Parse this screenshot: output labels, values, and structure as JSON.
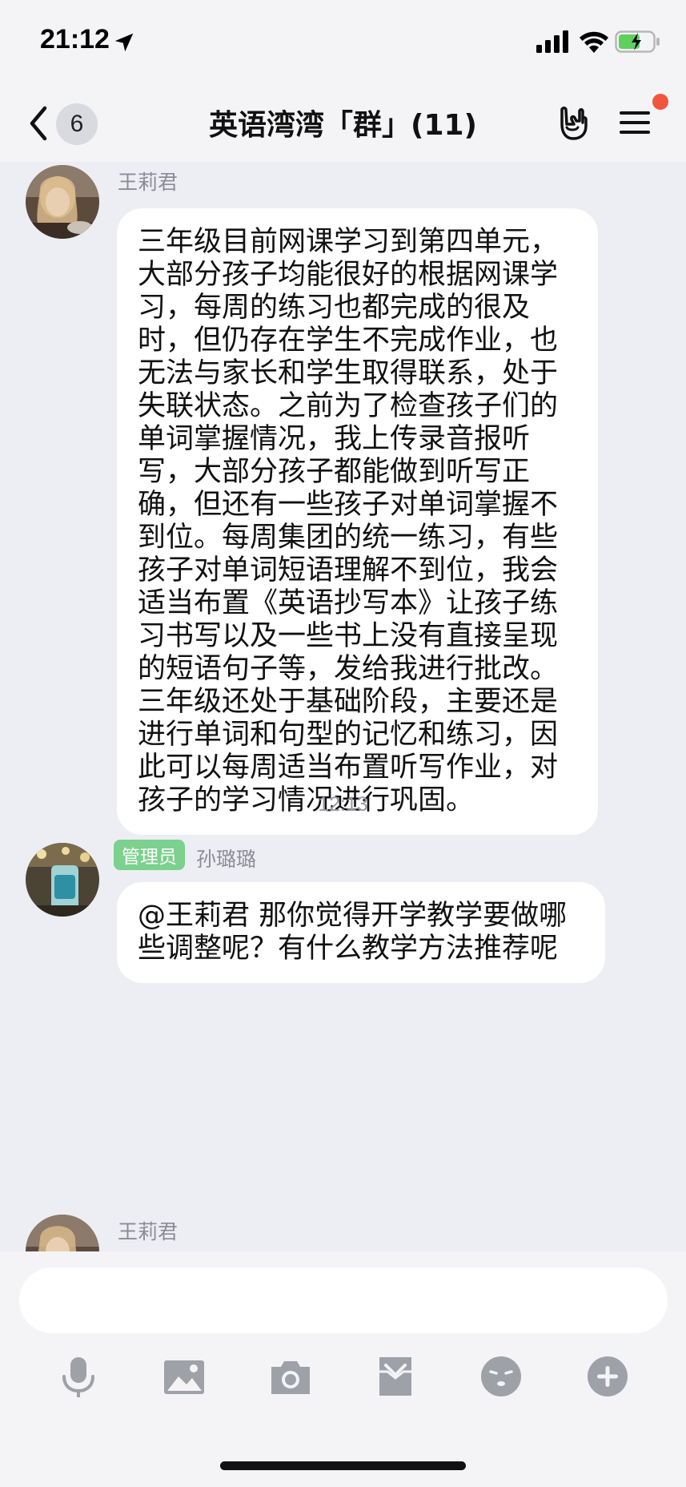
{
  "status_bar": {
    "time": "21:12",
    "icons": [
      "location-arrow-icon",
      "cellular-signal-icon",
      "wifi-icon",
      "battery-charging-icon"
    ]
  },
  "nav": {
    "unread_count": "6",
    "title": "英语湾湾「群」(11)",
    "icons": [
      "back-chevron-icon",
      "gesture-hand-icon",
      "menu-icon"
    ]
  },
  "messages": [
    {
      "sender": "王莉君",
      "text": "三年级目前网课学习到第四单元，大部分孩子均能很好的根据网课学习，每周的练习也都完成的很及时，但仍存在学生不完成作业，也无法与家长和学生取得联系，处于失联状态。之前为了检查孩子们的单词掌握情况，我上传录音报听写，大部分孩子都能做到听写正确，但还有一些孩子对单词掌握不到位。每周集团的统一练习，有些孩子对单词短语理解不到位，我会适当布置《英语抄写本》让孩子练习书写以及一些书上没有直接呈现的短语句子等，发给我进行批改。三年级还处于基础阶段，主要还是进行单词和句型的记忆和练习，因此可以每周适当布置听写作业，对孩子的学习情况进行巩固。"
    },
    {
      "timestamp": "12:13"
    },
    {
      "badge": "管理员",
      "sender": "孙璐璐",
      "text": "@王莉君 那你觉得开学教学要做哪些调整呢？有什么教学方法推荐呢"
    },
    {
      "sender": "王莉君"
    }
  ],
  "input": {
    "placeholder": ""
  },
  "toolbar": [
    "microphone-icon",
    "image-icon",
    "camera-icon",
    "file-icon",
    "emoji-icon",
    "plus-icon"
  ],
  "colors": {
    "background": "#edeef3",
    "bubble": "#ffffff",
    "admin_badge": "#7bd18d",
    "notification_dot": "#f2553e",
    "icon_gray": "#9fa1a8"
  }
}
